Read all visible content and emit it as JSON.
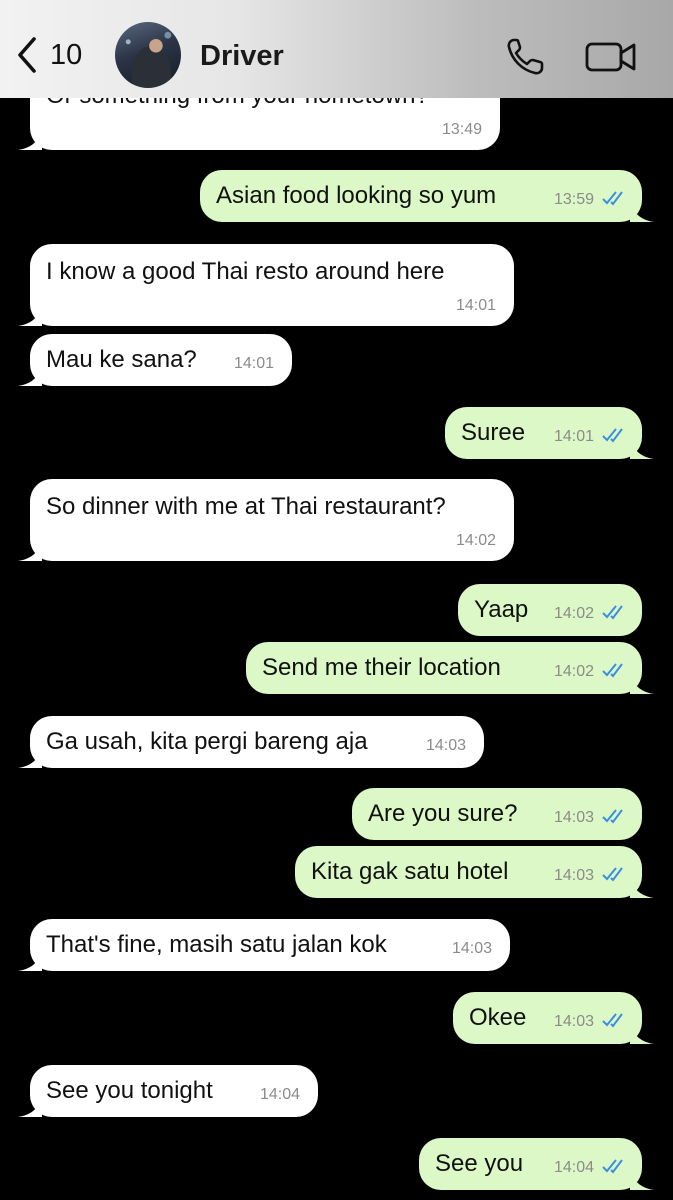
{
  "header": {
    "back_count": "10",
    "contact_name": "Driver",
    "icons": {
      "back": "chevron-left-icon",
      "call": "phone-icon",
      "video": "video-camera-icon"
    }
  },
  "colors": {
    "incoming": "#ffffff",
    "outgoing": "#dcf8c6",
    "read_check": "#3b8fe0"
  },
  "messages": [
    {
      "dir": "in",
      "text": "Or something from your hometown?",
      "time": "13:49"
    },
    {
      "dir": "out",
      "text": "Asian food looking so yum",
      "time": "13:59",
      "status": "read"
    },
    {
      "dir": "in",
      "text": "I know a good Thai resto around here",
      "time": "14:01"
    },
    {
      "dir": "in",
      "text": "Mau ke sana?",
      "time": "14:01"
    },
    {
      "dir": "out",
      "text": "Suree",
      "time": "14:01",
      "status": "read"
    },
    {
      "dir": "in",
      "text": "So dinner with me at Thai restaurant?",
      "time": "14:02"
    },
    {
      "dir": "out",
      "text": "Yaap",
      "time": "14:02",
      "status": "read"
    },
    {
      "dir": "out",
      "text": "Send me their location",
      "time": "14:02",
      "status": "read"
    },
    {
      "dir": "in",
      "text": "Ga usah, kita pergi bareng aja",
      "time": "14:03"
    },
    {
      "dir": "out",
      "text": "Are you sure?",
      "time": "14:03",
      "status": "read"
    },
    {
      "dir": "out",
      "text": "Kita gak satu hotel",
      "time": "14:03",
      "status": "read"
    },
    {
      "dir": "in",
      "text": "That's fine, masih satu jalan kok",
      "time": "14:03"
    },
    {
      "dir": "out",
      "text": "Okee",
      "time": "14:03",
      "status": "read"
    },
    {
      "dir": "in",
      "text": "See you tonight",
      "time": "14:04"
    },
    {
      "dir": "out",
      "text": "See you",
      "time": "14:04",
      "status": "read"
    }
  ]
}
